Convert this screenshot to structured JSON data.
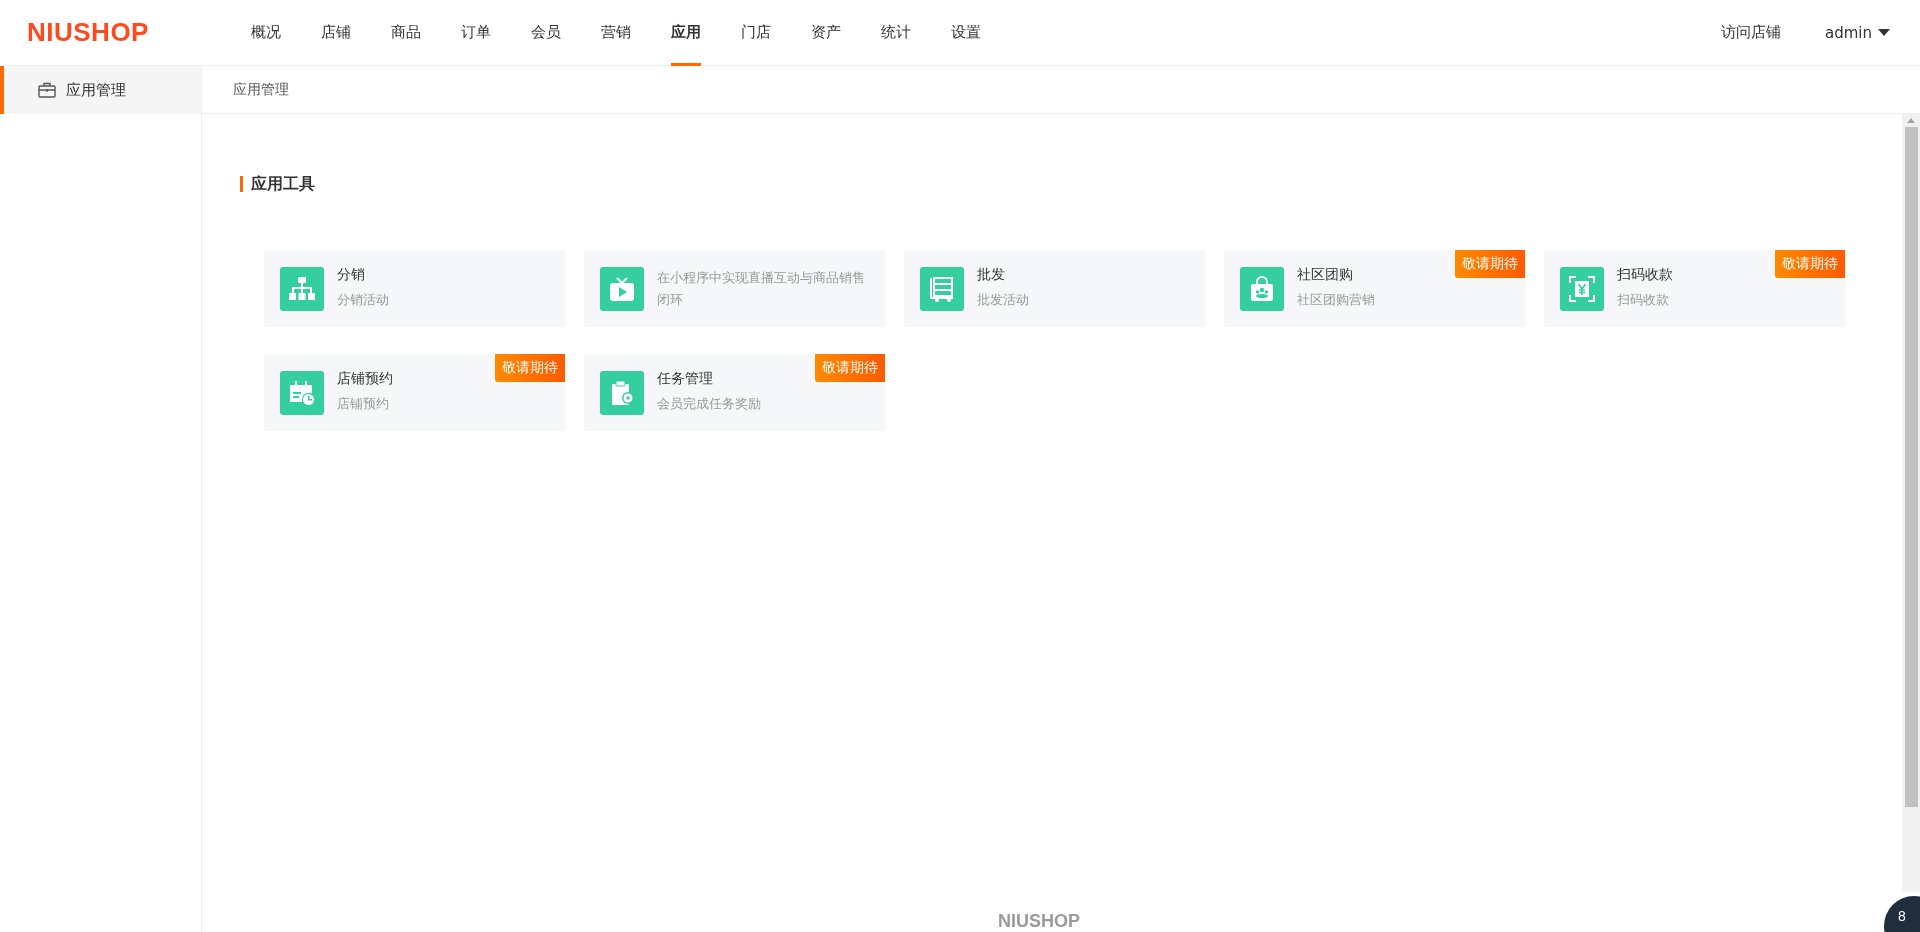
{
  "header": {
    "logo": "NIUSHOP",
    "nav": [
      {
        "label": "概况",
        "selected": false
      },
      {
        "label": "店铺",
        "selected": false
      },
      {
        "label": "商品",
        "selected": false
      },
      {
        "label": "订单",
        "selected": false
      },
      {
        "label": "会员",
        "selected": false
      },
      {
        "label": "营销",
        "selected": false
      },
      {
        "label": "应用",
        "selected": true
      },
      {
        "label": "门店",
        "selected": false
      },
      {
        "label": "资产",
        "selected": false
      },
      {
        "label": "统计",
        "selected": false
      },
      {
        "label": "设置",
        "selected": false
      }
    ],
    "visit_store": "访问店铺",
    "user": "admin"
  },
  "sidebar": {
    "items": [
      {
        "label": "应用管理",
        "selected": true
      }
    ]
  },
  "breadcrumb": "应用管理",
  "section_title": "应用工具",
  "cards": [
    {
      "title": "分销",
      "description": "分销活动"
    },
    {
      "description": "在小程序中实现直播互动与商品销售闭环"
    },
    {
      "title": "批发",
      "description": "批发活动"
    },
    {
      "title": "社区团购",
      "description": "社区团购营销",
      "badge": "敬请期待"
    },
    {
      "title": "扫码收款",
      "description": "扫码收款",
      "badge": "敬请期待"
    },
    {
      "title": "店铺预约",
      "description": "店铺预约",
      "badge": "敬请期待"
    },
    {
      "title": "任务管理",
      "description": "会员完成任务奖励",
      "badge": "敬请期待"
    }
  ],
  "footer_logo": "NIUSHOP",
  "float_badge": "8"
}
